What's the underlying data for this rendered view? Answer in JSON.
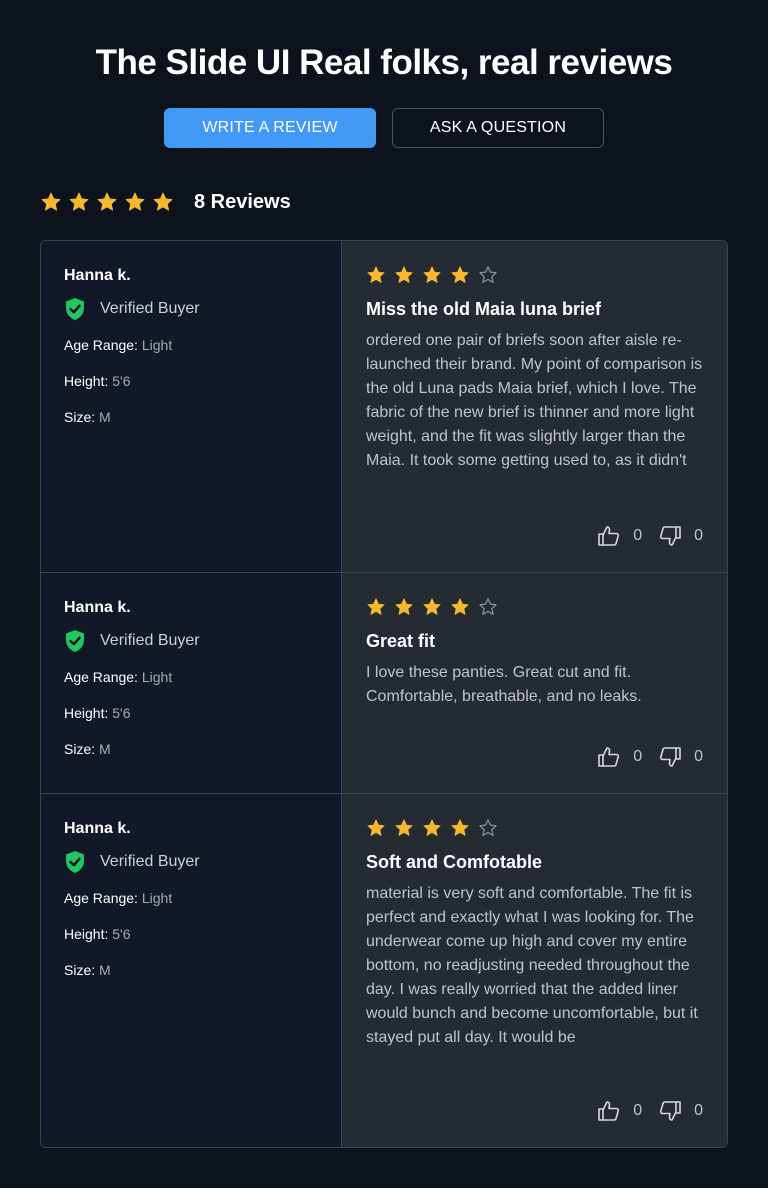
{
  "header": {
    "title": "The Slide UI Real folks, real reviews",
    "write_review_label": "WRITE A REVIEW",
    "ask_question_label": "ASK A QUESTION"
  },
  "summary": {
    "rating": 5,
    "review_count_label": "8 Reviews"
  },
  "colors": {
    "star_filled": "#f5b82e",
    "star_empty": "#8b929c",
    "verified_green": "#22c55e",
    "primary_button": "#4299f5"
  },
  "icons": {
    "star": "star-icon",
    "verified": "shield-check-icon",
    "helpful": "thumbs-up-icon",
    "not_helpful": "thumbs-down-icon"
  },
  "reviews": [
    {
      "reviewer": "Hanna k.",
      "verified_label": "Verified Buyer",
      "age_range_label": "Age Range:",
      "age_range": "Light",
      "height_label": "Height:",
      "height": "5'6",
      "size_label": "Size:",
      "size": "M",
      "rating": 4,
      "title": "Miss the old Maia luna brief",
      "body": "ordered one pair of briefs soon after aisle re-launched their brand. My point of comparison is the old Luna pads Maia brief, which I love. The fabric of the new brief is thinner and more light weight, and the fit was slightly larger than the Maia. It took some getting used to, as it didn't",
      "helpful": "0",
      "not_helpful": "0"
    },
    {
      "reviewer": "Hanna k.",
      "verified_label": "Verified Buyer",
      "age_range_label": "Age Range:",
      "age_range": "Light",
      "height_label": "Height:",
      "height": "5'6",
      "size_label": "Size:",
      "size": "M",
      "rating": 4,
      "title": "Great fit",
      "body": "I love these panties. Great cut and fit. Comfortable, breathable, and no leaks.",
      "helpful": "0",
      "not_helpful": "0"
    },
    {
      "reviewer": "Hanna k.",
      "verified_label": "Verified Buyer",
      "age_range_label": "Age Range:",
      "age_range": "Light",
      "height_label": "Height:",
      "height": "5'6",
      "size_label": "Size:",
      "size": "M",
      "rating": 4,
      "title": "Soft and Comfotable",
      "body": "material is very soft and comfortable. The fit is perfect and exactly what I was looking for. The underwear come up high and cover my entire bottom, no readjusting needed throughout the day. I was really worried that the added liner would bunch and become uncomfortable, but it stayed put all day. It would be",
      "helpful": "0",
      "not_helpful": "0"
    }
  ]
}
